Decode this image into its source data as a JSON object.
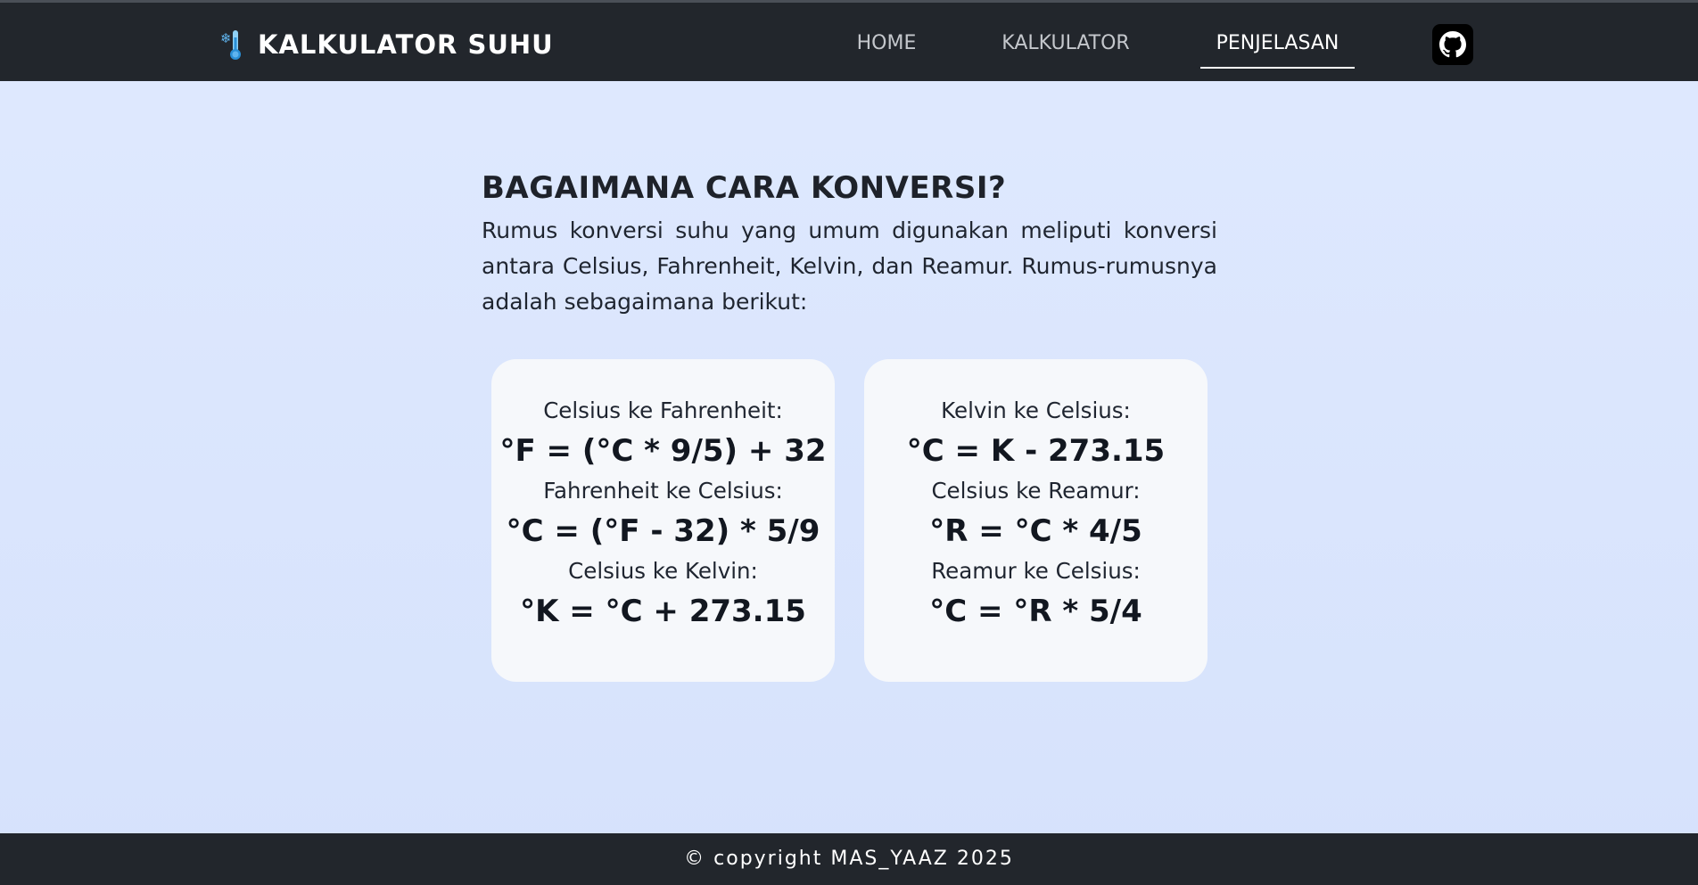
{
  "nav": {
    "brand_icon": "thermometer-snowflake-icon",
    "brand_title": "KALKULATOR SUHU",
    "links": [
      {
        "label": "HOME",
        "active": false
      },
      {
        "label": "KALKULATOR",
        "active": false
      },
      {
        "label": "PENJELASAN",
        "active": true
      }
    ],
    "github_icon": "github-icon"
  },
  "main": {
    "heading": "BAGAIMANA CARA KONVERSI?",
    "intro": "Rumus konversi suhu yang umum digunakan meliputi konversi antara Celsius, Fahrenheit, Kelvin, dan Reamur. Rumus-rumusnya adalah sebagaimana berikut:",
    "cards": [
      {
        "formulas": [
          {
            "label": "Celsius ke Fahrenheit:",
            "formula": "°F = (°C * 9/5) + 32"
          },
          {
            "label": "Fahrenheit ke Celsius:",
            "formula": "°C = (°F - 32) * 5/9"
          },
          {
            "label": "Celsius ke Kelvin:",
            "formula": "°K = °C + 273.15"
          }
        ]
      },
      {
        "formulas": [
          {
            "label": "Kelvin ke Celsius:",
            "formula": "°C = K - 273.15"
          },
          {
            "label": "Celsius ke Reamur:",
            "formula": "°R = °C * 4/5"
          },
          {
            "label": "Reamur ke Celsius:",
            "formula": "°C = °R * 5/4"
          }
        ]
      }
    ]
  },
  "footer": {
    "copyright": "© copyright MAS_YAAZ 2025"
  },
  "colors": {
    "navbar_bg": "#22262c",
    "page_bg": "#dfe9fe",
    "card_bg": "#f6f8fb",
    "active_link": "#ffffff",
    "inactive_link": "#c4c7cc"
  }
}
